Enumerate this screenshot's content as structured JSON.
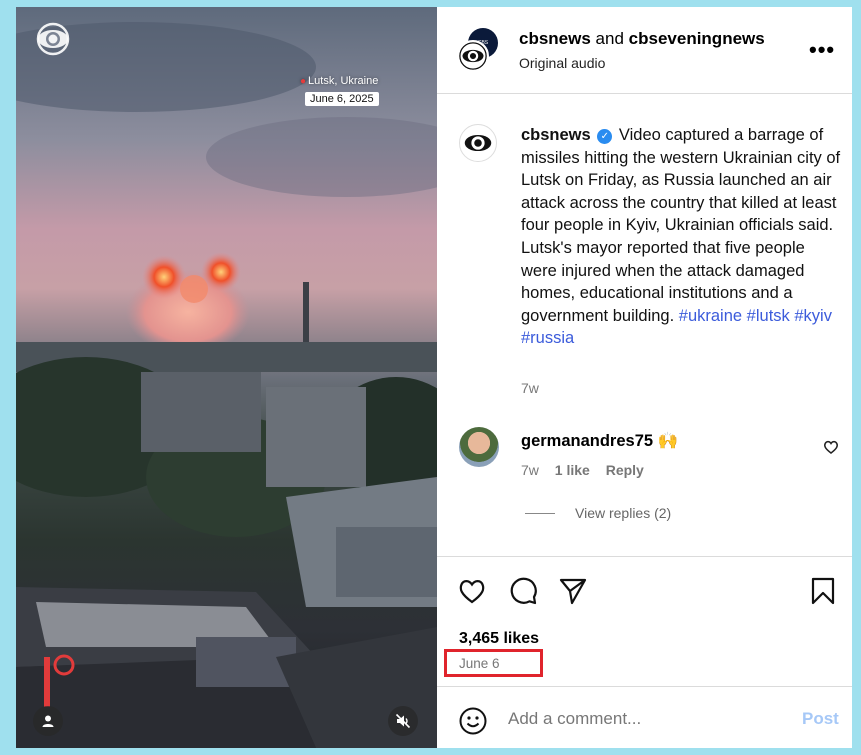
{
  "video": {
    "location": "Lutsk, Ukraine",
    "date_tag": "June 6, 2025",
    "icons": [
      "cbs-eye-logo",
      "user-icon",
      "mute-icon"
    ]
  },
  "header": {
    "user1": "cbsnews",
    "joiner": "and",
    "user2": "cbseveningnews",
    "audio": "Original audio",
    "more": "•••"
  },
  "caption": {
    "username": "cbsnews",
    "text": "Video captured a barrage of missiles hitting the western Ukrainian city of Lutsk on Friday, as Russia launched an air attack across the country that killed at least four people in Kyiv, Ukrainian officials said. Lutsk's mayor reported that five people were injured when the attack damaged homes, educational institutions and a government building.",
    "tags": [
      "#ukraine",
      "#lutsk",
      "#kyiv",
      "#russia"
    ],
    "age": "7w"
  },
  "comment": {
    "username": "germanandres75",
    "emoji": "🙌",
    "age": "7w",
    "likes": "1 like",
    "reply": "Reply",
    "view_replies": "View replies (2)"
  },
  "footer": {
    "likes": "3,465 likes",
    "date": "June 6",
    "highlight_color": "#e0242c",
    "add_comment_placeholder": "Add a comment...",
    "post_label": "Post"
  }
}
